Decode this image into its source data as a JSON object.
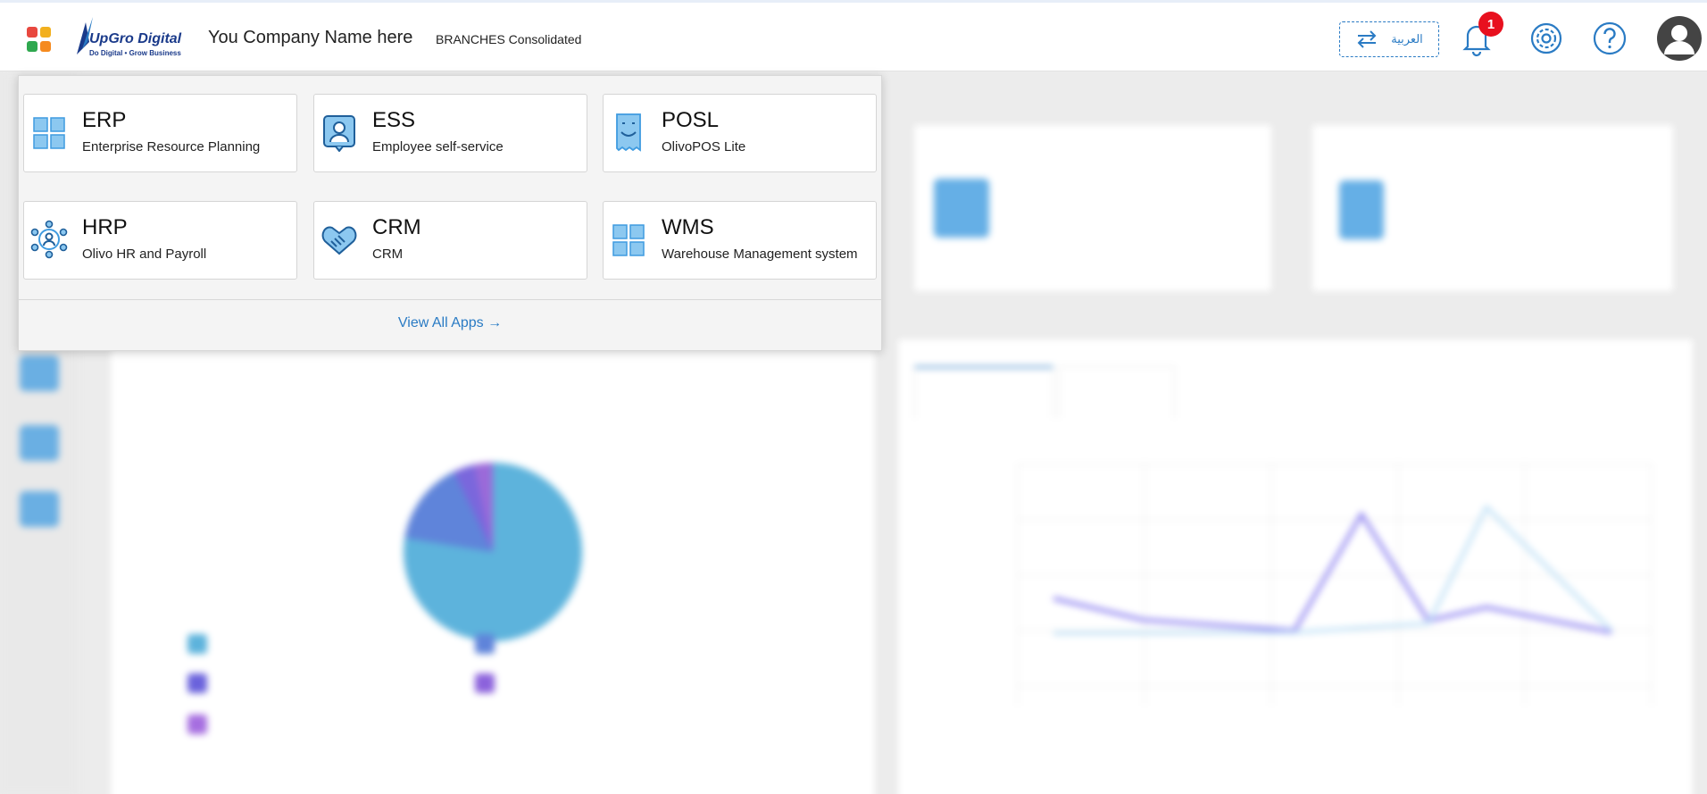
{
  "header": {
    "logo_name": "UpGro Digital",
    "logo_tagline": "Do Digital • Grow Business",
    "company_name": "You Company Name here",
    "branch": "BRANCHES Consolidated",
    "language_label": "العربية",
    "notification_count": "1",
    "icons": [
      "apps-grid-icon",
      "swap-icon",
      "bell-icon",
      "settings-icon",
      "help-icon",
      "user-avatar-icon"
    ]
  },
  "launcher": {
    "apps": [
      {
        "name": "ERP",
        "description": "Enterprise Resource Planning",
        "icon": "erp-grid-icon"
      },
      {
        "name": "ESS",
        "description": "Employee self-service",
        "icon": "employee-badge-icon"
      },
      {
        "name": "POSL",
        "description": "OlivoPOS Lite",
        "icon": "receipt-icon"
      },
      {
        "name": "HRP",
        "description": "Olivo HR and Payroll",
        "icon": "hr-network-icon"
      },
      {
        "name": "CRM",
        "description": "CRM",
        "icon": "handshake-icon"
      },
      {
        "name": "WMS",
        "description": "Warehouse Management system",
        "icon": "warehouse-grid-icon"
      }
    ],
    "view_all_label": "View All Apps →"
  },
  "colors": {
    "accent": "#2a7bc4",
    "badge": "#e8101e",
    "icon_blue": "#3f9be0"
  }
}
